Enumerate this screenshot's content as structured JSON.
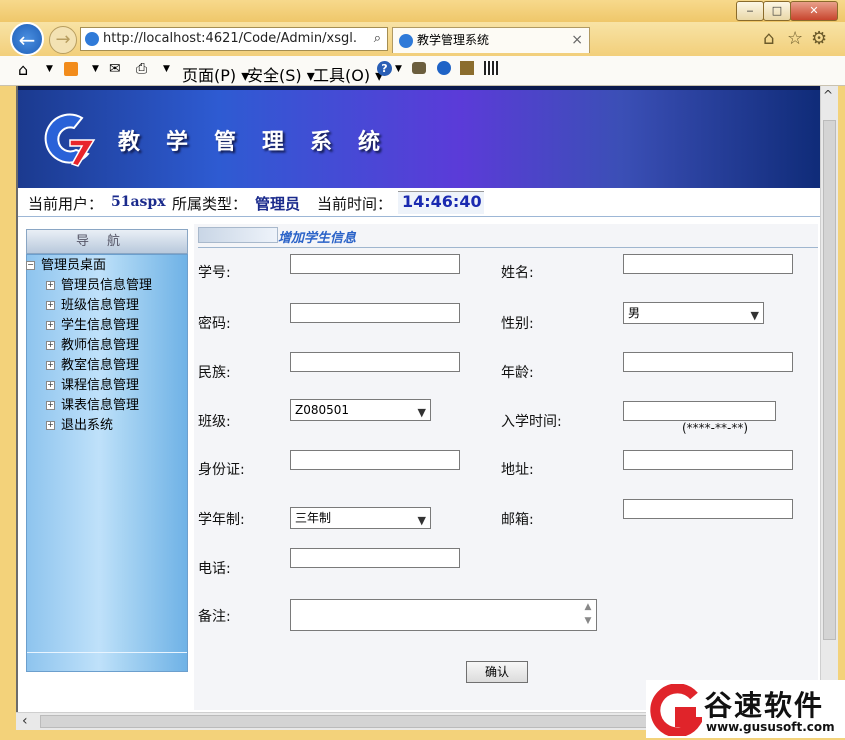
{
  "window": {
    "minimize": "‒",
    "maximize": "□",
    "close": "✕"
  },
  "browser": {
    "back_icon": "back-arrow-icon",
    "address": "http://localhost:4621/Code/Admin/xsgl.",
    "search_sym": "⌕",
    "tab_title": "教学管理系统",
    "tab_close": "×",
    "toolbar": {
      "page": "页面(P)",
      "safety": "安全(S)",
      "tools": "工具(O)"
    }
  },
  "header": {
    "system_title": "教学管理系统"
  },
  "infobar": {
    "user_label": "当前用户：",
    "user_value": "51aspx",
    "type_label": "所属类型：",
    "type_value": "管理员",
    "time_label": "当前时间：",
    "time_value": "14:46:40"
  },
  "sidebar": {
    "title": "导航",
    "root": "管理员桌面",
    "items": [
      "管理员信息管理",
      "班级信息管理",
      "学生信息管理",
      "教师信息管理",
      "教室信息管理",
      "课程信息管理",
      "课表信息管理",
      "退出系统"
    ]
  },
  "form": {
    "heading": "增加学生信息",
    "fields": {
      "student_no": {
        "label": "学号:",
        "value": ""
      },
      "name": {
        "label": "姓名:",
        "value": ""
      },
      "password": {
        "label": "密码:",
        "value": ""
      },
      "gender": {
        "label": "性别:",
        "value": "男"
      },
      "ethnicity": {
        "label": "民族:",
        "value": ""
      },
      "age": {
        "label": "年龄:",
        "value": ""
      },
      "class": {
        "label": "班级:",
        "value": "Z080501"
      },
      "enroll_date": {
        "label": "入学时间:",
        "value": "",
        "hint": "(****-**-**)"
      },
      "id_card": {
        "label": "身份证:",
        "value": ""
      },
      "address": {
        "label": "地址:",
        "value": ""
      },
      "schooling": {
        "label": "学年制:",
        "value": "三年制"
      },
      "email": {
        "label": "邮箱:",
        "value": ""
      },
      "phone": {
        "label": "电话:",
        "value": ""
      },
      "remark": {
        "label": "备注:",
        "value": ""
      }
    },
    "confirm": "确认"
  },
  "watermark": {
    "brand": "谷速软件",
    "url": "www.gususoft.com"
  }
}
